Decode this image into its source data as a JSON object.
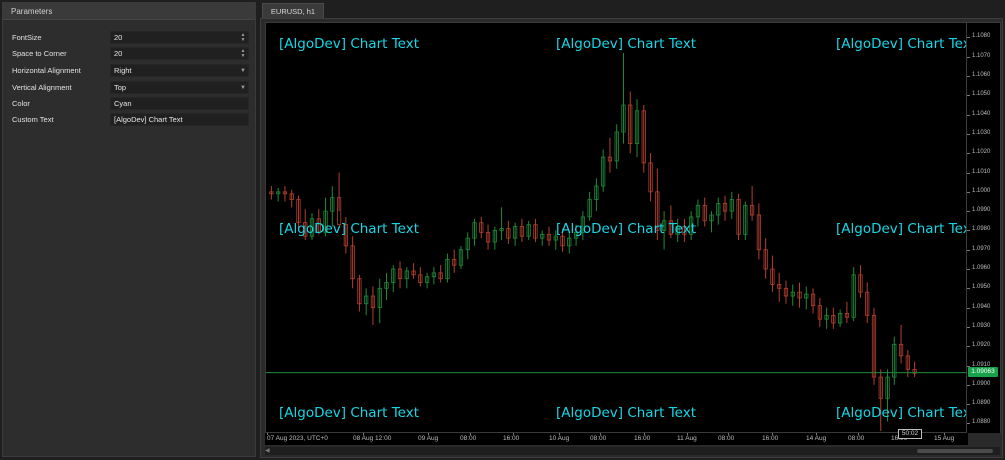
{
  "parameters": {
    "title": "Parameters",
    "rows": [
      {
        "label": "FontSize",
        "value": "20",
        "control": "spin"
      },
      {
        "label": "Space to Corner",
        "value": "20",
        "control": "spin"
      },
      {
        "label": "Horizontal Alignment",
        "value": "Right",
        "control": "dropdown"
      },
      {
        "label": "Vertical Alignment",
        "value": "Top",
        "control": "dropdown"
      },
      {
        "label": "Color",
        "value": "Cyan",
        "control": "text"
      },
      {
        "label": "Custom Text",
        "value": "[AlgoDev] Chart Text",
        "control": "text"
      }
    ]
  },
  "chart_tab": "EURUSD, h1",
  "overlay_text": "[AlgoDev] Chart Text",
  "overlay_color": "#18d6e6",
  "current_price": "1.09063",
  "countdown": "50:02",
  "price_labels": [
    "1.1080",
    "1.1070",
    "1.1060",
    "1.1050",
    "1.1040",
    "1.1030",
    "1.1020",
    "1.1010",
    "1.1000",
    "1.0990",
    "1.0980",
    "1.0970",
    "1.0960",
    "1.0950",
    "1.0940",
    "1.0930",
    "1.0920",
    "1.0910",
    "1.0900",
    "1.0890",
    "1.0880"
  ],
  "time_labels": [
    "07 Aug 2023, UTC+0",
    "08 Aug 12:00",
    "09 Aug",
    "08:00",
    "16:00",
    "10 Aug",
    "08:00",
    "16:00",
    "11 Aug",
    "08:00",
    "16:00",
    "14 Aug",
    "08:00",
    "16:00",
    "15 Aug"
  ],
  "colors": {
    "bull": "#1e8a3a",
    "bear": "#b3402f",
    "price_line": "#1e8a3a"
  },
  "chart_data": {
    "type": "candlestick",
    "symbol": "EURUSD",
    "timeframe": "h1",
    "current_price": 1.09063,
    "candles": [
      [
        1.1,
        1.1003,
        1.0996,
        1.0999
      ],
      [
        1.0999,
        1.1002,
        1.0995,
        1.1
      ],
      [
        1.1,
        1.1003,
        1.0995,
        1.0999
      ],
      [
        1.0999,
        1.1001,
        1.0992,
        1.0996
      ],
      [
        1.0996,
        1.0998,
        1.098,
        1.0984
      ],
      [
        1.0984,
        1.0991,
        1.0975,
        1.0977
      ],
      [
        1.0977,
        1.0989,
        1.0975,
        1.0986
      ],
      [
        1.0986,
        1.0991,
        1.0978,
        1.0979
      ],
      [
        1.0979,
        1.0997,
        1.0977,
        1.099
      ],
      [
        1.099,
        1.1003,
        1.0982,
        1.0997
      ],
      [
        1.0997,
        1.101,
        1.099,
        1.0983
      ],
      [
        1.0983,
        1.0987,
        1.0968,
        1.0972
      ],
      [
        1.0972,
        1.0977,
        1.095,
        1.0955
      ],
      [
        1.0955,
        1.0957,
        1.0938,
        1.0942
      ],
      [
        1.0942,
        1.095,
        1.0936,
        1.0946
      ],
      [
        1.0946,
        1.0951,
        1.0931,
        1.094
      ],
      [
        1.094,
        1.0955,
        1.0932,
        1.095
      ],
      [
        1.095,
        1.0958,
        1.0944,
        1.0953
      ],
      [
        1.0953,
        1.0962,
        1.0948,
        1.096
      ],
      [
        1.096,
        1.0964,
        1.095,
        1.0955
      ],
      [
        1.0955,
        1.0961,
        1.095,
        1.0959
      ],
      [
        1.0959,
        1.0963,
        1.0955,
        1.0957
      ],
      [
        1.0957,
        1.0961,
        1.0951,
        1.0953
      ],
      [
        1.0953,
        1.0958,
        1.095,
        1.0956
      ],
      [
        1.0956,
        1.0961,
        1.0952,
        1.0958
      ],
      [
        1.0958,
        1.0962,
        1.0953,
        1.0955
      ],
      [
        1.0955,
        1.0968,
        1.0953,
        1.0965
      ],
      [
        1.0965,
        1.097,
        1.0958,
        1.0962
      ],
      [
        1.0962,
        1.0972,
        1.096,
        1.097
      ],
      [
        1.097,
        1.0979,
        1.0965,
        1.0976
      ],
      [
        1.0976,
        1.0986,
        1.0972,
        1.0984
      ],
      [
        1.0984,
        1.0987,
        1.0976,
        1.0979
      ],
      [
        1.0979,
        1.0983,
        1.097,
        1.0974
      ],
      [
        1.0974,
        1.0982,
        1.097,
        1.098
      ],
      [
        1.098,
        1.0992,
        1.0975,
        1.0981
      ],
      [
        1.0981,
        1.0985,
        1.0973,
        1.0976
      ],
      [
        1.0976,
        1.0984,
        1.0972,
        1.0982
      ],
      [
        1.0982,
        1.0986,
        1.0974,
        1.0977
      ],
      [
        1.0977,
        1.0985,
        1.0975,
        1.0983
      ],
      [
        1.0983,
        1.0986,
        1.0974,
        1.0976
      ],
      [
        1.0976,
        1.098,
        1.0972,
        1.0978
      ],
      [
        1.0978,
        1.0982,
        1.0972,
        1.0975
      ],
      [
        1.0975,
        1.098,
        1.097,
        1.0977
      ],
      [
        1.0977,
        1.0981,
        1.0969,
        1.0972
      ],
      [
        1.0972,
        1.0979,
        1.0968,
        1.0976
      ],
      [
        1.0976,
        1.0983,
        1.0972,
        1.0979
      ],
      [
        1.0979,
        1.099,
        1.0975,
        1.0987
      ],
      [
        1.0987,
        1.1,
        1.0985,
        1.0996
      ],
      [
        1.0996,
        1.1007,
        1.099,
        1.1003
      ],
      [
        1.1003,
        1.1022,
        1.1,
        1.1018
      ],
      [
        1.1018,
        1.1028,
        1.101,
        1.1016
      ],
      [
        1.1016,
        1.1035,
        1.1012,
        1.1031
      ],
      [
        1.1031,
        1.1072,
        1.1025,
        1.1045
      ],
      [
        1.1045,
        1.1052,
        1.102,
        1.1025
      ],
      [
        1.1025,
        1.1048,
        1.1018,
        1.1042
      ],
      [
        1.1042,
        1.1045,
        1.101,
        1.1015
      ],
      [
        1.1015,
        1.102,
        1.0995,
        1.1
      ],
      [
        1.1,
        1.1012,
        1.0975,
        1.098
      ],
      [
        1.098,
        1.099,
        1.097,
        1.0985
      ],
      [
        1.0985,
        1.0993,
        1.0976,
        1.0978
      ],
      [
        1.0978,
        1.0986,
        1.0974,
        1.0982
      ],
      [
        1.0982,
        1.0986,
        1.0974,
        1.0978
      ],
      [
        1.0978,
        1.099,
        1.0975,
        1.0987
      ],
      [
        1.0987,
        1.0996,
        1.0982,
        1.0993
      ],
      [
        1.0993,
        1.0997,
        1.0982,
        1.0985
      ],
      [
        1.0985,
        1.099,
        1.0979,
        1.0988
      ],
      [
        1.0988,
        1.0997,
        1.0983,
        1.0994
      ],
      [
        1.0994,
        1.0998,
        1.0985,
        1.099
      ],
      [
        1.099,
        1.1,
        1.0986,
        1.0996
      ],
      [
        1.0996,
        1.0999,
        1.0975,
        1.0978
      ],
      [
        1.0978,
        1.0995,
        1.0975,
        1.0993
      ],
      [
        1.0993,
        1.1003,
        1.0985,
        1.0988
      ],
      [
        1.0988,
        1.0994,
        1.0965,
        1.097
      ],
      [
        1.097,
        1.0976,
        1.0955,
        1.096
      ],
      [
        1.096,
        1.0967,
        1.0948,
        1.0952
      ],
      [
        1.0952,
        1.0958,
        1.0943,
        1.095
      ],
      [
        1.095,
        1.0954,
        1.0942,
        1.0946
      ],
      [
        1.0946,
        1.0952,
        1.0941,
        1.0948
      ],
      [
        1.0948,
        1.0953,
        1.094,
        1.0945
      ],
      [
        1.0945,
        1.0951,
        1.0939,
        1.0947
      ],
      [
        1.0947,
        1.095,
        1.0937,
        1.0941
      ],
      [
        1.0941,
        1.0945,
        1.093,
        1.0934
      ],
      [
        1.0934,
        1.094,
        1.0929,
        1.0936
      ],
      [
        1.0936,
        1.094,
        1.0929,
        1.0932
      ],
      [
        1.0932,
        1.0939,
        1.093,
        1.0937
      ],
      [
        1.0937,
        1.0943,
        1.0932,
        1.0935
      ],
      [
        1.0935,
        1.0961,
        1.0933,
        1.0957
      ],
      [
        1.0957,
        1.0962,
        1.0945,
        1.0948
      ],
      [
        1.0948,
        1.0953,
        1.0932,
        1.0936
      ],
      [
        1.0936,
        1.094,
        1.09,
        1.0904
      ],
      [
        1.0904,
        1.0908,
        1.0876,
        1.0893
      ],
      [
        1.0893,
        1.0908,
        1.0881,
        1.0904
      ],
      [
        1.0904,
        1.0925,
        1.09,
        1.0921
      ],
      [
        1.0921,
        1.0931,
        1.0911,
        1.0915
      ],
      [
        1.0915,
        1.0918,
        1.0904,
        1.0908
      ],
      [
        1.0908,
        1.0912,
        1.0904,
        1.0906
      ]
    ]
  }
}
